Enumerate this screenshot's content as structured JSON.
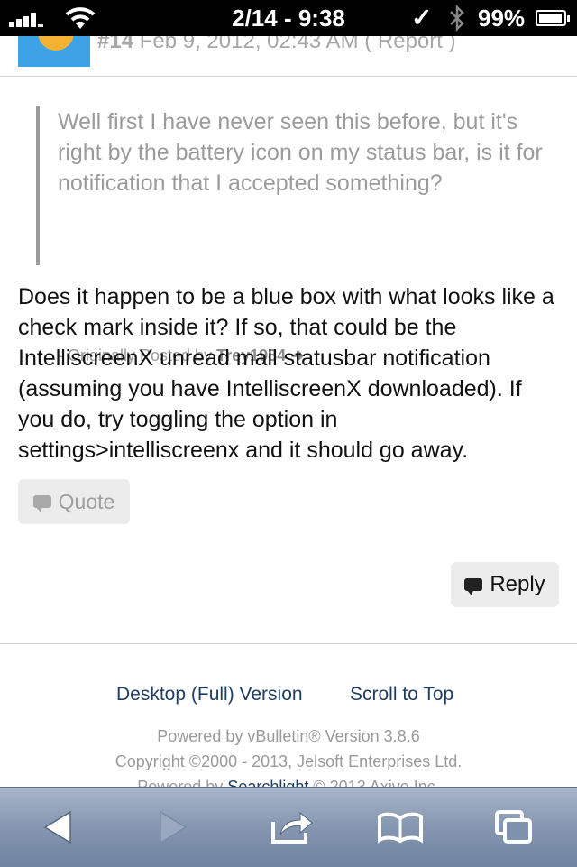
{
  "status_bar": {
    "time": "2/14 - 9:38",
    "battery_percent": "99%",
    "battery_level": 0.99,
    "signal_bars": 4
  },
  "post_header": {
    "number": "#14",
    "date": "Feb 9, 2012, 02:43 AM",
    "report_link": "( Report )"
  },
  "quote": {
    "text": "Well first I have never seen this before, but it's right by the battery icon on my status bar, is it for notification that I accepted something?",
    "attribution_prefix": "- Originally Posted by",
    "author": "Trey1984",
    "arrow": "➜"
  },
  "post": {
    "body": "Does it happen to be a blue box with what looks like a check mark inside it? If so, that could be the IntelliscreenX unread mail statusbar notification (assuming you have IntelliscreenX downloaded). If you do, try toggling the option in settings>intelliscreenx and it should go away."
  },
  "buttons": {
    "quote_label": "Quote",
    "reply_label": "Reply"
  },
  "footer": {
    "desktop_link": "Desktop (Full) Version",
    "scroll_top_link": "Scroll to Top",
    "powered_by": "Powered by vBulletin® Version 3.8.6",
    "copyright": "Copyright ©2000 - 2013, Jelsoft Enterprises Ltd.",
    "searchlight_prefix": "Powered by",
    "searchlight_link": "Searchlight",
    "searchlight_suffix": "© 2013 Axivo Inc."
  },
  "toolbar": {
    "icons": [
      "back-icon",
      "forward-icon",
      "share-icon",
      "bookmarks-icon",
      "pages-icon"
    ]
  },
  "colors": {
    "link": "#1f3e63",
    "toolbar": "#8596b0",
    "avatar_blue": "#3ea3e6",
    "avatar_sun": "#f4b233"
  }
}
